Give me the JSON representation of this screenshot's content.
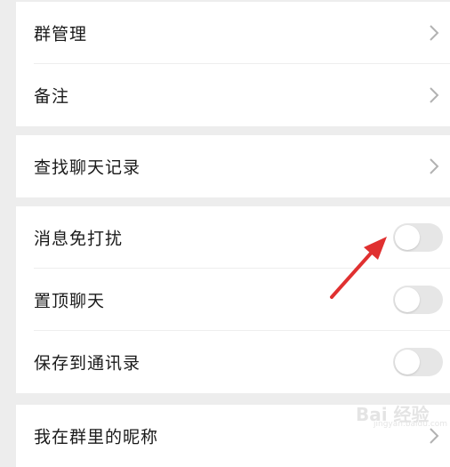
{
  "settings": {
    "group1": [
      {
        "label": "群管理",
        "control": "chevron"
      },
      {
        "label": "备注",
        "control": "chevron"
      }
    ],
    "group2": [
      {
        "label": "查找聊天记录",
        "control": "chevron"
      }
    ],
    "group3": [
      {
        "label": "消息免打扰",
        "control": "toggle",
        "on": false
      },
      {
        "label": "置顶聊天",
        "control": "toggle",
        "on": false
      },
      {
        "label": "保存到通讯录",
        "control": "toggle",
        "on": false
      }
    ],
    "group4": [
      {
        "label": "我在群里的昵称",
        "control": "chevron"
      }
    ]
  },
  "annotation": {
    "arrow_color": "#e03030",
    "points_to": "消息免打扰 toggle"
  },
  "watermark": {
    "text": "Bai 经验",
    "url": "jingyan.baidu.com"
  },
  "colors": {
    "background": "#ededed",
    "row": "#ffffff",
    "text": "#1a1a1a",
    "chevron": "#b2b2b2",
    "toggle_off": "#e6e6e6"
  }
}
